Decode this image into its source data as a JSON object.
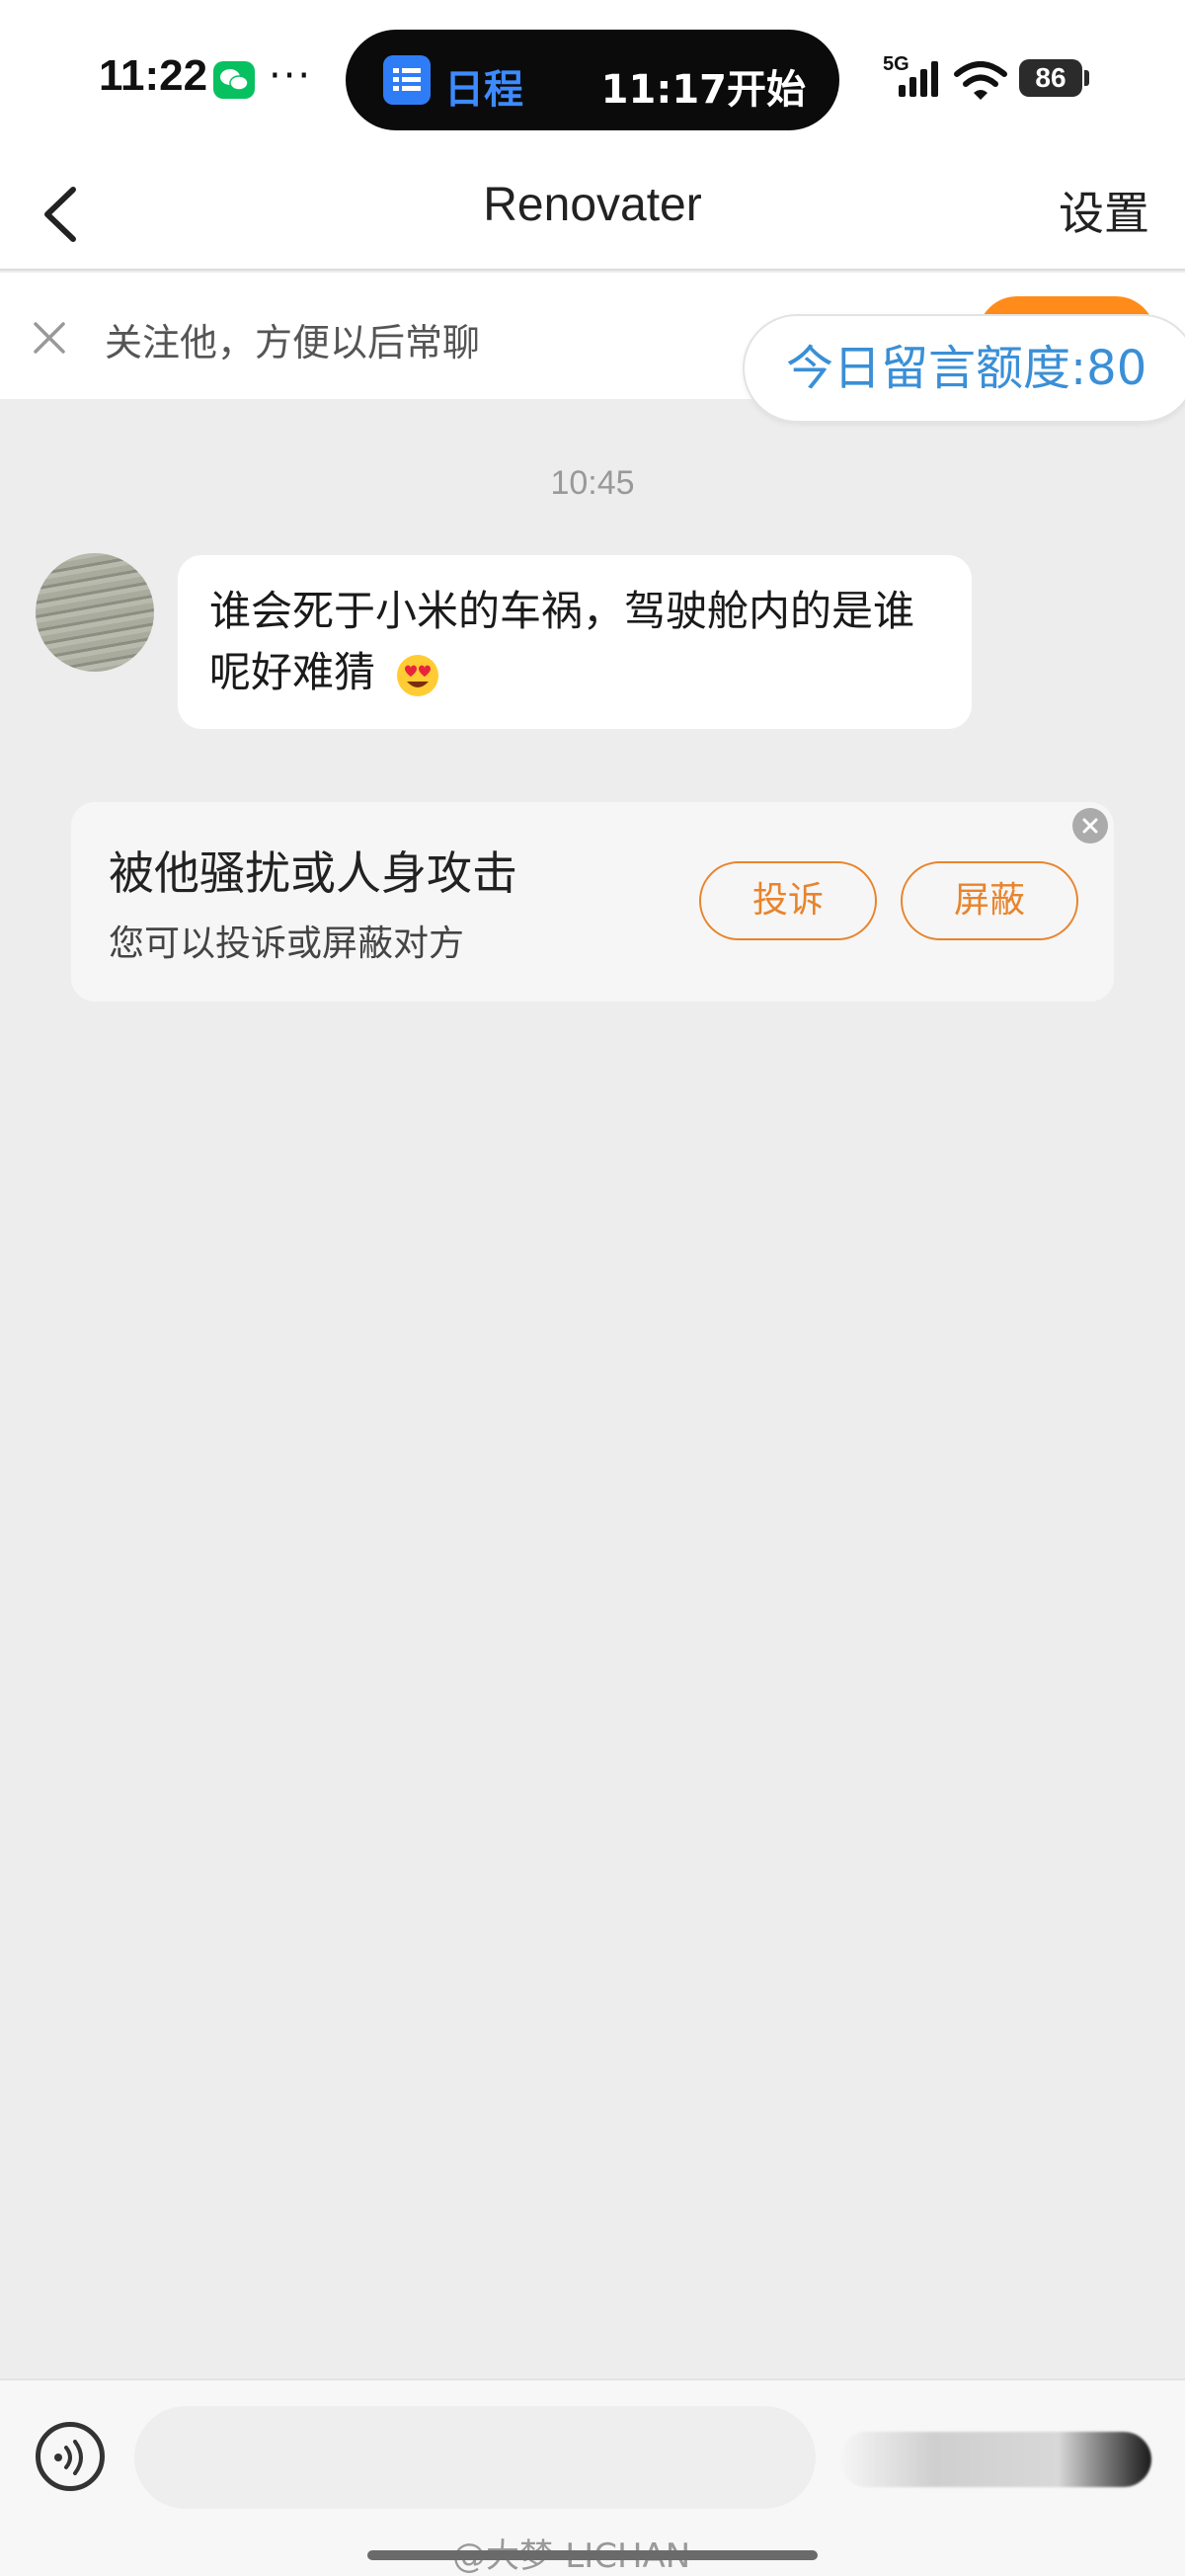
{
  "status_bar": {
    "time": "11:22",
    "more": "···",
    "island_label": "日程",
    "island_time": "11:17开始",
    "network": "5G",
    "battery": "86"
  },
  "header": {
    "title": "Renovater",
    "settings_label": "设置"
  },
  "follow_banner": {
    "text": "关注他，方便以后常聊",
    "quota": "今日留言额度:80"
  },
  "chat": {
    "timestamp": "10:45",
    "message": "谁会死于小米的车祸，驾驶舱内的是谁呢好难猜"
  },
  "notice": {
    "title": "被他骚扰或人身攻击",
    "subtitle": "您可以投诉或屏蔽对方",
    "report_label": "投诉",
    "block_label": "屏蔽"
  },
  "input_bar": {
    "placeholder": ""
  },
  "watermark": "@大梦-LICHAN",
  "colors": {
    "accent_orange": "#e8842c",
    "quota_blue": "#3a8fd6",
    "background": "#ededed"
  }
}
